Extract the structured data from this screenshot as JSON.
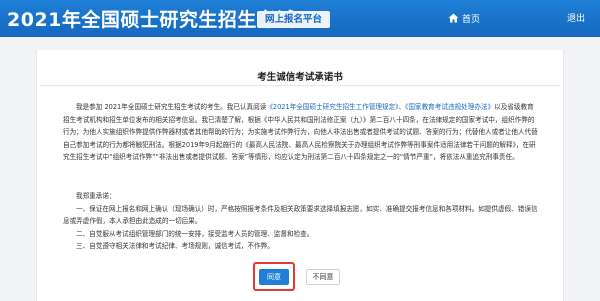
{
  "header": {
    "site_title": "2021年全国硕士研究生招生考试",
    "platform_tag": "网上报名平台",
    "home_label": "首页",
    "logout_label": "退出"
  },
  "page": {
    "title": "考生诚信考试承诺书"
  },
  "pledge": {
    "p1_a": "我是参加 2021年全国硕士研究生招生考试的考生。我已认真阅读",
    "link1": "《2021年全国硕士研究生招生工作管理规定》",
    "p1_b": "、",
    "link2": "《国家教育考试违规处理办法》",
    "p1_c": "以及省级教育招生考试机构和招生单位发布的相关招考信息。我已清楚了解，根据《中华人民共和国刑法修正案（九）》第二百八十四条，在法律规定的国家考试中，组织作弊的行为；为他人实施组织作弊提供作弊器材或者其他帮助的行为；为实施考试作弊行为，向他人非法出售或者提供考试的试题、答案的行为；代替他人或者让他人代替自己参加考试的行为都将触犯刑法。根据2019年9月起施行的《最高人民法院、最高人民检察院关于办理组织考试作弊等刑事案件适用法律若干问题的解释》，在研究生招生考试中“组织考试作弊”“非法出售或者提供试题、答案”等情形，均应认定为刑法第二百八十四条规定之一的“情节严重”，将依法从重追究刑事责任。",
    "promise_intro": "我郑重承诺：",
    "promise_1": "一、保证在网上报名和网上确认（现场确认）时，严格按照报考条件及相关政策要求选择填报志愿，如实、准确提交报考信息和各项材料。如提供虚假、错误信息或弄虚作假，本人承担由此造成的一切后果。",
    "promise_2": "二、自觉服从考试组织管理部门的统一安排，接受监考人员的管理、监督和检查。",
    "promise_3": "三、自觉遵守相关法律和考试纪律、考场规则，诚信考试，不作弊。"
  },
  "actions": {
    "agree_label": "同意",
    "disagree_label": "不同意"
  },
  "colors": {
    "header_blue": "#1f7fd6",
    "link_blue": "#1668bd",
    "highlight_red": "#e53935"
  },
  "icons": {
    "home": "home-icon"
  }
}
